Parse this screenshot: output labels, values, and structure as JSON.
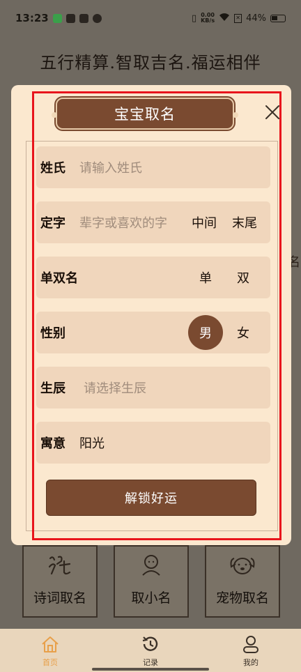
{
  "status_bar": {
    "time": "13:23",
    "net_speed_value": "0.00",
    "net_speed_unit": "KB/s",
    "battery": "44%"
  },
  "page": {
    "title": "五行精算.智取吉名.福运相伴",
    "side_char": "名",
    "cards": [
      {
        "label": "诗词取名",
        "icon": "poem-glyph-icon"
      },
      {
        "label": "取小名",
        "icon": "person-face-icon"
      },
      {
        "label": "宠物取名",
        "icon": "dog-face-icon"
      }
    ]
  },
  "modal": {
    "title": "宝宝取名",
    "surname": {
      "label": "姓氏",
      "placeholder": "请输入姓氏"
    },
    "fixed_char": {
      "label": "定字",
      "placeholder": "辈字或喜欢的字",
      "options": [
        "中间",
        "末尾"
      ]
    },
    "name_length": {
      "label": "单双名",
      "options": [
        "单",
        "双"
      ]
    },
    "gender": {
      "label": "性别",
      "options": [
        "男",
        "女"
      ],
      "selected": "男"
    },
    "birth": {
      "label": "生辰",
      "placeholder": "请选择生辰"
    },
    "meaning": {
      "label": "寓意",
      "value": "阳光"
    },
    "submit_label": "解锁好运"
  },
  "nav": {
    "items": [
      {
        "label": "首页",
        "icon": "home-icon",
        "active": true
      },
      {
        "label": "记录",
        "icon": "history-icon",
        "active": false
      },
      {
        "label": "我的",
        "icon": "user-icon",
        "active": false
      }
    ]
  },
  "colors": {
    "accent_brown": "#7a4a30",
    "modal_bg": "#fbe8cf",
    "row_bg": "#f0d6bc",
    "highlight": "#e8141c",
    "nav_active": "#e8a04a"
  }
}
